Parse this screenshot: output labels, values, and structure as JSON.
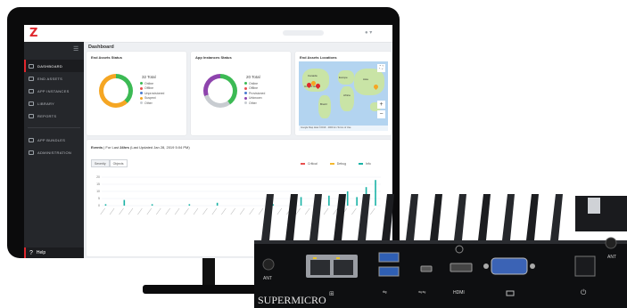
{
  "app": {
    "logo": "Z",
    "page_title": "Dashboard"
  },
  "sidebar": {
    "items": [
      {
        "label": "DASHBOARD",
        "active": true
      },
      {
        "label": "END ASSETS"
      },
      {
        "label": "APP INSTANCES"
      },
      {
        "label": "LIBRARY"
      },
      {
        "label": "REPORTS"
      },
      {
        "label": "APP BUNDLES"
      },
      {
        "label": "ADMINISTRATION"
      }
    ],
    "help": "Help"
  },
  "end_assets": {
    "title": "End Assets Status",
    "total": "32 Total",
    "legend": [
      "Online",
      "Offline",
      "Unprovisioned",
      "Suspect",
      "Other"
    ]
  },
  "app_instances": {
    "title": "App Instances Status",
    "total": "20 Total",
    "legend": [
      "Online",
      "Offline",
      "Provisioned",
      "Unknown",
      "Other"
    ]
  },
  "locations": {
    "title": "End Assets Locations",
    "labels": [
      "Canada",
      "United States",
      "Brazil",
      "Europe",
      "Africa",
      "Asia"
    ],
    "footer": "Google  Map data ©2019 · 2000 km  Terms of Use"
  },
  "events": {
    "title": "Events",
    "range_prefix": "For Last",
    "range": "24hrs",
    "updated": "(Last Updated Jan 28, 2019 5:04 PM)",
    "tabs": [
      "Severity",
      "Objects"
    ],
    "legend": [
      "Critical",
      "Debug",
      "Info"
    ],
    "y_ticks": [
      "20",
      "15",
      "10",
      "5",
      "0"
    ]
  },
  "colors": {
    "brand": "#e0272d",
    "online": "#3cba54",
    "offline": "#f5a623",
    "provisioned": "#8e44ad",
    "info": "#1ab3a6",
    "critical": "#e8504f",
    "debug": "#f5b82e"
  },
  "chart_data": {
    "type": "bar",
    "series": [
      {
        "name": "Info",
        "values": [
          1,
          0,
          4,
          0,
          0,
          1,
          0,
          0,
          0,
          1,
          0,
          0,
          2,
          0,
          0,
          0,
          0,
          0,
          1,
          0,
          0,
          6,
          0,
          3,
          7,
          0,
          10,
          6,
          13,
          18
        ]
      },
      {
        "name": "Debug",
        "values": [
          0,
          0,
          0,
          0,
          0,
          0,
          0,
          0,
          0,
          0,
          0,
          0,
          0,
          0,
          0,
          0,
          0,
          0,
          0,
          0,
          0,
          0,
          0,
          0,
          0,
          0,
          0,
          0,
          0,
          0
        ]
      },
      {
        "name": "Critical",
        "values": [
          0,
          0,
          0,
          0,
          0,
          0,
          0,
          0,
          0,
          0,
          0,
          0,
          0,
          0,
          0,
          0,
          0,
          0,
          0,
          0,
          0,
          0,
          0,
          0,
          0,
          0,
          0,
          0,
          0,
          0
        ]
      }
    ],
    "ylim": [
      0,
      20
    ],
    "title": "",
    "xlabel": "",
    "ylabel": ""
  },
  "hardware": {
    "brand": "SUPERMICRO",
    "port_labels": [
      "ANT",
      "HDMI",
      "ANT"
    ]
  }
}
